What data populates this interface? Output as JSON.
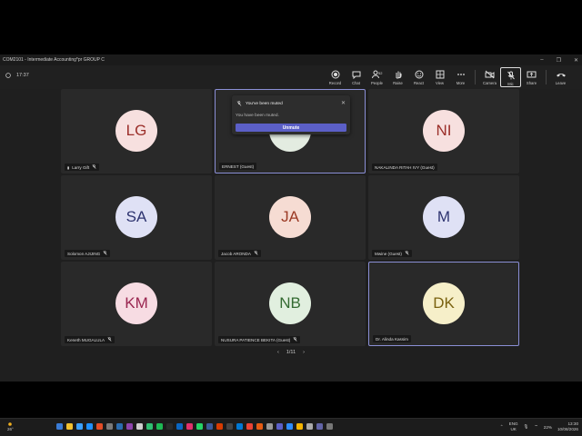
{
  "window": {
    "title": "COM2101 - Intermediate Accounting*pr GROUP C",
    "controls": [
      "–",
      "❐",
      "✕"
    ]
  },
  "toolbar": {
    "timer": "17:37",
    "tools": [
      {
        "label": "Record",
        "icon": "record-icon"
      },
      {
        "label": "Chat",
        "icon": "chat-icon"
      },
      {
        "label": "People",
        "icon": "people-icon",
        "count": "52"
      },
      {
        "label": "Raise",
        "icon": "raise-hand-icon"
      },
      {
        "label": "React",
        "icon": "react-icon"
      },
      {
        "label": "View",
        "icon": "view-icon"
      },
      {
        "label": "More",
        "icon": "more-icon"
      }
    ],
    "camera_label": "Camera",
    "mic_label": "Mic",
    "share_label": "Share",
    "leave_label": "Leave"
  },
  "participants": [
    {
      "initials": "LG",
      "name": "Larry Gift",
      "bg": "#f7e0df",
      "fg": "#9b2f2a",
      "muted": true,
      "signal": true
    },
    {
      "initials": "",
      "name": "ERNEST (Guest)",
      "bg": "#e3ece1",
      "fg": "#3f6d3a",
      "muted": false,
      "bordered": true
    },
    {
      "initials": "NI",
      "name": "NAKALINDA RITAH IVY (Guest)",
      "bg": "#f7e0df",
      "fg": "#9b2f2a",
      "muted": false
    },
    {
      "initials": "SA",
      "name": "Solomon AJIJING",
      "bg": "#dfe1f5",
      "fg": "#2e3470",
      "muted": true
    },
    {
      "initials": "JA",
      "name": "Jacob ARONDA",
      "bg": "#f6dcd3",
      "fg": "#9b3a24",
      "muted": true
    },
    {
      "initials": "M",
      "name": "Mwine (Guest)",
      "bg": "#dfe1f5",
      "fg": "#2e3470",
      "muted": true
    },
    {
      "initials": "KM",
      "name": "Keneth MUGALULA",
      "bg": "#f7dce3",
      "fg": "#9a2650",
      "muted": true
    },
    {
      "initials": "NB",
      "name": "NUSURA PATIENCE BEKITA (Guest)",
      "bg": "#e1efdf",
      "fg": "#346b32",
      "muted": true
    },
    {
      "initials": "DK",
      "name": "Dr. Alinda Kassim",
      "bg": "#f6efc9",
      "fg": "#7a6210",
      "muted": false,
      "bordered": true
    }
  ],
  "pager": {
    "text": "1/11",
    "prev": "‹",
    "next": "›"
  },
  "toast": {
    "title": "You've been muted",
    "message": "You have been muted.",
    "button": "Unmute",
    "close": "✕"
  },
  "taskbar": {
    "temperature": "26°",
    "language_top": "ENG",
    "language_bottom": "UK",
    "battery": "22%",
    "time": "13:30",
    "date": "10/08/2026",
    "app_colors": [
      "#3a7bd5",
      "#f2c12e",
      "#3aa0ff",
      "#1e90ff",
      "#e34c26",
      "#7a7a7a",
      "#2b6cb0",
      "#8e44ad",
      "#cfcfcf",
      "#2fbf71",
      "#1db954",
      "#2b2b2b",
      "#0a66c2",
      "#e1306c",
      "#25d366",
      "#3b5998",
      "#d83b01",
      "#444",
      "#0078d4",
      "#ea4335",
      "#e55b13",
      "#999",
      "#5b5fc7",
      "#2d8cff",
      "#f4b400",
      "#aaa",
      "#6264a7",
      "#777"
    ]
  }
}
